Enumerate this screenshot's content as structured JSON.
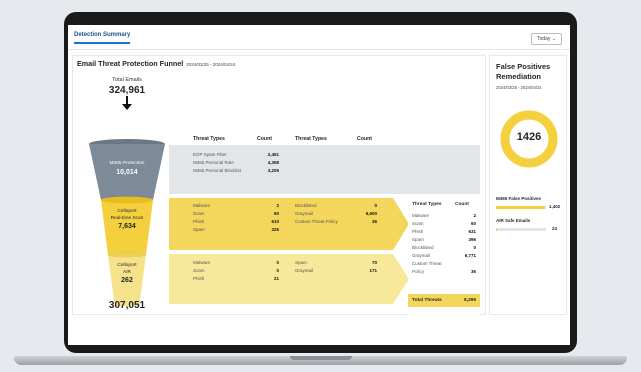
{
  "tabs": {
    "active": "Detection Summary"
  },
  "controls": {
    "date_range": "Today"
  },
  "funnel": {
    "title": "Email Threat Protection Funnel",
    "date": "2024/03/25 - 2024/04/24",
    "total_emails_label": "Total Emails",
    "total_emails": "324,961",
    "safe_emails": "307,051",
    "safe_emails_label": "Safe Emails",
    "stages": [
      {
        "name": "M365 Protection",
        "value": "10,014"
      },
      {
        "name_line1": "Celloport",
        "name_line2": "Real-time Scan",
        "value": "7,634"
      },
      {
        "name_line1": "Celloport",
        "name_line2": "AIR",
        "value": "262"
      }
    ]
  },
  "threat_table": {
    "col_threat_types": "Threat Types",
    "col_count": "Count",
    "gray_rows": [
      {
        "label": "EOP Spam Filter",
        "value": "2,451"
      },
      {
        "label": "M365 Personal Rule",
        "value": "4,358"
      },
      {
        "label": "M365 Personal Blocklist",
        "value": "3,205"
      }
    ],
    "rt_left": [
      {
        "label": "Malware",
        "value": "2"
      },
      {
        "label": "Scam",
        "value": "60"
      },
      {
        "label": "Phish",
        "value": "610"
      },
      {
        "label": "Spam",
        "value": "326"
      }
    ],
    "rt_right": [
      {
        "label": "Blocklisted",
        "value": "0"
      },
      {
        "label": "Graymail",
        "value": "6,600"
      },
      {
        "label": "Custom Threat Policy",
        "value": "36"
      }
    ],
    "air_left": [
      {
        "label": "Malware",
        "value": "0"
      },
      {
        "label": "Scam",
        "value": "0"
      },
      {
        "label": "Phish",
        "value": "21"
      }
    ],
    "air_right": [
      {
        "label": "Spam",
        "value": "70"
      },
      {
        "label": "Graymail",
        "value": "171"
      }
    ]
  },
  "summary": {
    "col_threat_types": "Threat Types",
    "col_count": "Count",
    "rows": [
      {
        "label": "Malware",
        "value": "2"
      },
      {
        "label": "Scam",
        "value": "60"
      },
      {
        "label": "Phish",
        "value": "631"
      },
      {
        "label": "Spam",
        "value": "396"
      },
      {
        "label": "Blocklisted",
        "value": "0"
      },
      {
        "label": "Graymail",
        "value": "6,771"
      },
      {
        "label": "Custom Threat",
        "value": ""
      },
      {
        "label": "Policy",
        "value": "36"
      }
    ],
    "total_label": "Total Threats",
    "total_value": "8,296"
  },
  "remediation": {
    "title_line1": "False Positives",
    "title_line2": "Remediation",
    "date": "2024/03/25 - 2024/04/24",
    "donut_value": "1426",
    "m365_label": "M365 False Positives",
    "m365_value": "1,402",
    "m365_fraction": 0.98,
    "air_label": "AIR Safe Emails",
    "air_value": "24",
    "air_fraction": 0.02
  },
  "colors": {
    "yellow": "#f4d03f",
    "yellow_light": "#f8e89a",
    "gray_band": "#e3e6e9",
    "funnel_gray": "#7d8a97",
    "tab_blue": "#1f6fd0"
  }
}
